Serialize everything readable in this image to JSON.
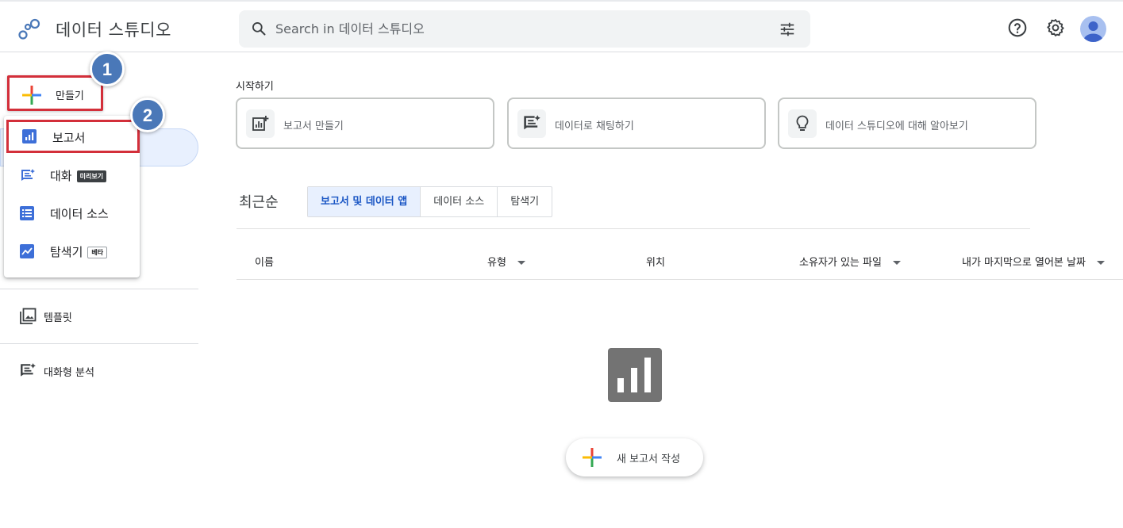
{
  "header": {
    "app_title": "데이터 스튜디오",
    "search_placeholder": "Search in 데이터 스튜디오"
  },
  "sidebar": {
    "create_label": "만들기",
    "step_badges": [
      "1",
      "2"
    ],
    "create_menu": [
      {
        "label": "보고서",
        "icon": "bar-chart-icon",
        "tag": ""
      },
      {
        "label": "대화",
        "icon": "chat-spark-icon",
        "tag": "미리보기"
      },
      {
        "label": "데이터 소스",
        "icon": "list-icon",
        "tag": ""
      },
      {
        "label": "탐색기",
        "icon": "trend-icon",
        "tag": "베타"
      }
    ],
    "nav": [
      {
        "label": "템플릿",
        "icon": "template-icon"
      },
      {
        "label": "대화형 분석",
        "icon": "chat-spark-icon"
      }
    ]
  },
  "main": {
    "start_title": "시작하기",
    "start_cards": [
      {
        "label": "보고서 만들기",
        "icon": "add-chart-icon"
      },
      {
        "label": "데이터로 채팅하기",
        "icon": "chat-spark-icon"
      },
      {
        "label": "데이터 스튜디오에 대해 알아보기",
        "icon": "lightbulb-icon"
      }
    ],
    "recent_label": "최근순",
    "tabs": [
      "보고서 및 데이터 앱",
      "데이터 소스",
      "탐색기"
    ],
    "active_tab": 0,
    "columns": [
      "이름",
      "유형",
      "위치",
      "소유자가 있는 파일",
      "내가 마지막으로 열어본 날짜"
    ],
    "new_report_label": "새 보고서 작성"
  },
  "colors": {
    "accent": "#1a73e8",
    "highlight_border": "#d32f3a",
    "badge": "#4a78b8"
  }
}
